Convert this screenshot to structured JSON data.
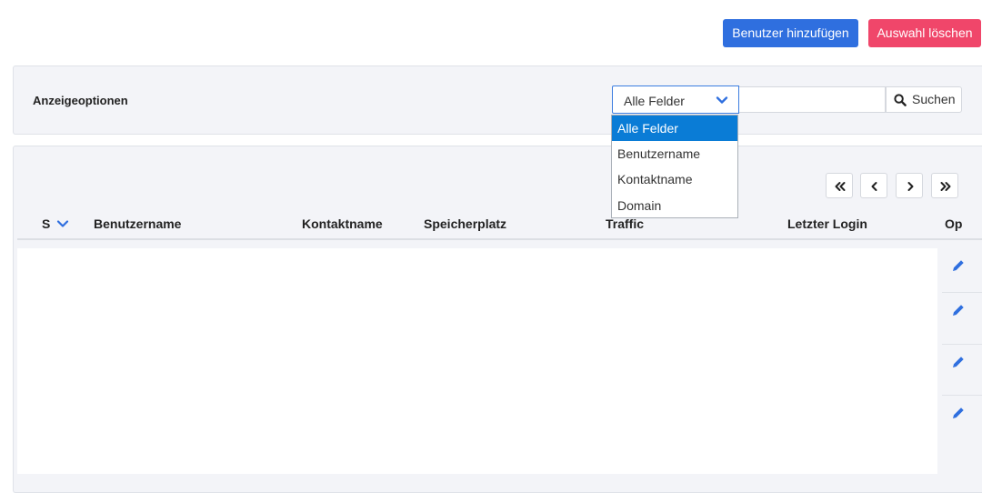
{
  "toolbar": {
    "add_user_label": "Benutzer hinzufügen",
    "delete_selection_label": "Auswahl löschen"
  },
  "options": {
    "title": "Anzeigeoptionen",
    "field_select": {
      "value": "Alle Felder",
      "options": [
        "Alle Felder",
        "Benutzername",
        "Kontaktname",
        "Domain"
      ],
      "selected_index": 0
    },
    "search": {
      "value": "",
      "button_label": "Suchen"
    }
  },
  "table": {
    "columns": {
      "s": "S",
      "username": "Benutzername",
      "contact": "Kontaktname",
      "storage": "Speicherplatz",
      "traffic": "Traffic",
      "last_login": "Letzter Login",
      "options": "Op"
    },
    "row_action_icon": "pencil-icon"
  },
  "colors": {
    "primary": "#2f6fdf",
    "danger": "#f0466a",
    "selected": "#0a7cd6",
    "panel": "#f3f4f8"
  }
}
